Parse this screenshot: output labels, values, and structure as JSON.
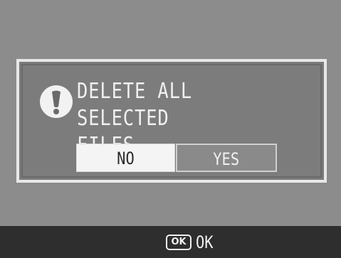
{
  "dialog": {
    "message": "DELETE ALL SELECTED\nFILES",
    "icon": "exclamation-icon"
  },
  "buttons": {
    "no_label": "NO",
    "yes_label": "YES",
    "selected": "NO"
  },
  "footer": {
    "ok_icon_text": "OK",
    "ok_label": "OK"
  },
  "colors": {
    "background": "#8c8c8c",
    "dialog_border": "#e8e8e8",
    "selected_button": "#f4f4f4",
    "footer_bar": "#2e2e2e"
  }
}
